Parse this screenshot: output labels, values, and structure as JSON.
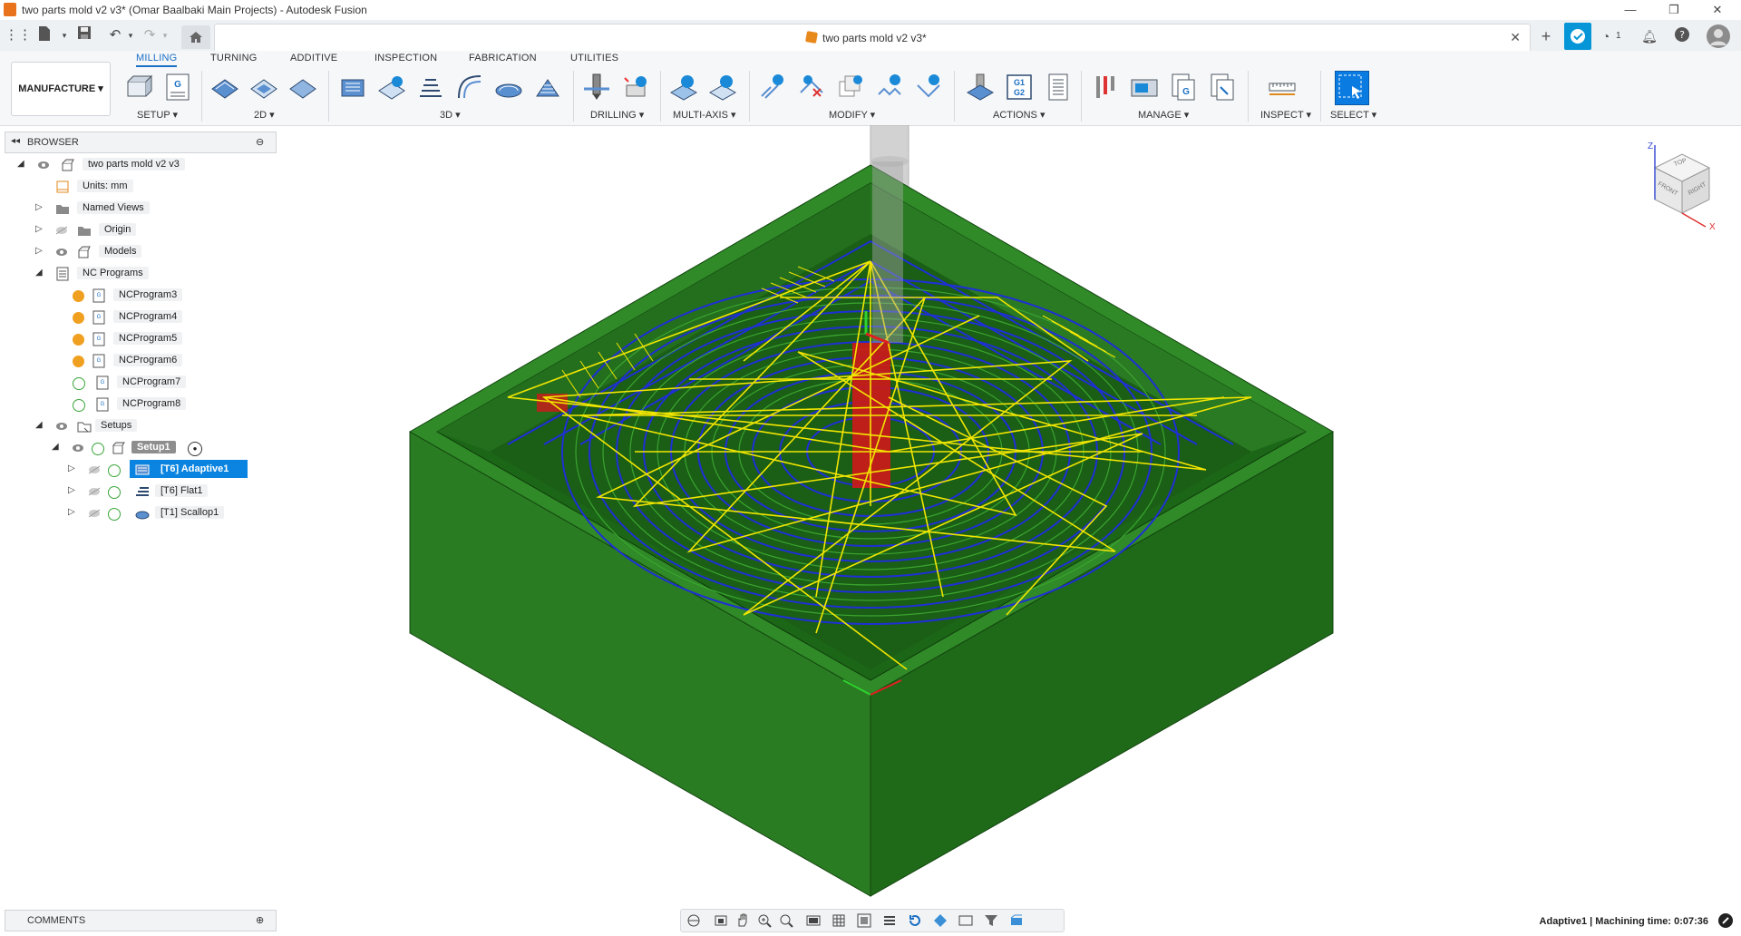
{
  "window": {
    "title": "two parts mold v2 v3* (Omar Baalbaki Main Projects) - Autodesk Fusion",
    "controls": [
      "—",
      "❐",
      "✕"
    ]
  },
  "tabs": {
    "home_icon": "home-icon",
    "document_tab_label": "two parts mold v2 v3*",
    "close": "✕",
    "job_count": "1"
  },
  "ribbon": {
    "workspace": "MANUFACTURE",
    "tabs": [
      "MILLING",
      "TURNING",
      "ADDITIVE",
      "INSPECTION",
      "FABRICATION",
      "UTILITIES"
    ],
    "active_tab": "MILLING",
    "groups": [
      "SETUP",
      "2D",
      "3D",
      "DRILLING",
      "MULTI-AXIS",
      "MODIFY",
      "ACTIONS",
      "MANAGE",
      "INSPECT",
      "SELECT"
    ],
    "actions_g_label": "G1\nG2"
  },
  "browser": {
    "title": "BROWSER",
    "root": "two parts mold v2 v3",
    "units": "Units: mm",
    "named_views": "Named Views",
    "origin": "Origin",
    "models": "Models",
    "nc_programs": "NC Programs",
    "programs": [
      {
        "label": "NCProgram3",
        "status": "warning"
      },
      {
        "label": "NCProgram4",
        "status": "warning"
      },
      {
        "label": "NCProgram5",
        "status": "warning"
      },
      {
        "label": "NCProgram6",
        "status": "warning"
      },
      {
        "label": "NCProgram7",
        "status": "ok"
      },
      {
        "label": "NCProgram8",
        "status": "ok"
      }
    ],
    "setups": "Setups",
    "setup1": "Setup1",
    "operations": [
      {
        "label": "[T6] Adaptive1",
        "selected": true
      },
      {
        "label": "[T6] Flat1",
        "selected": false
      },
      {
        "label": "[T1] Scallop1",
        "selected": false
      }
    ]
  },
  "comments": {
    "title": "COMMENTS"
  },
  "status": {
    "text": "Adaptive1 | Machining time: 0:07:36"
  },
  "viewcube": {
    "top": "TOP",
    "front": "FRONT",
    "right": "RIGHT",
    "z": "Z",
    "x": "X"
  },
  "colors": {
    "accent": "#1a6fc4",
    "stock_green": "#1f7a1f",
    "toolpath_blue": "#1f2fd6",
    "toolpath_yellow": "#f2e600",
    "warning": "#f0a020",
    "ok": "#3aa53a"
  }
}
